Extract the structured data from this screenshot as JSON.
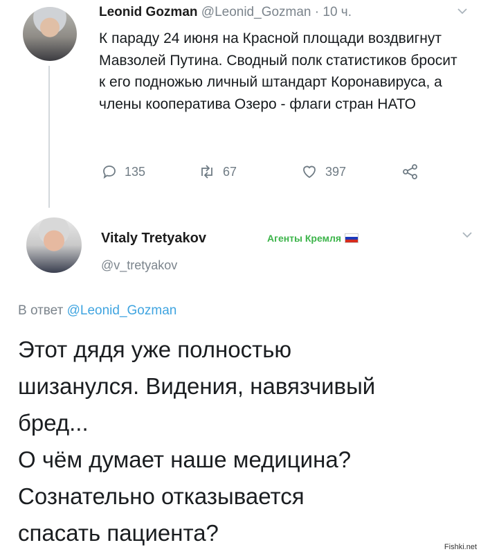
{
  "tweet1": {
    "author_name": "Leonid Gozman",
    "handle": "@Leonid_Gozman",
    "time": "· 10 ч.",
    "text": "К параду 24 июня на Красной площади воздвигнут Мавзолей Путина. Сводный полк статистиков бросит к его подножью личный штандарт Коронавируса, а члены кооператива Озеро - флаги стран НАТО",
    "replies": "135",
    "retweets": "67",
    "likes": "397"
  },
  "tweet2": {
    "author_name": "Vitaly Tretyakov",
    "badge": "Агенты Кремля",
    "handle": "@v_tretyakov",
    "reply_prefix": "В ответ",
    "reply_to": "@Leonid_Gozman",
    "lines": [
      "Этот дядя уже полностью",
      "шизанулся. Видения, навязчивый",
      "бред...",
      "О чём думает наше медицина?",
      "Сознательно отказывается",
      "спасать пациента?"
    ]
  },
  "watermark": "Fishki.net",
  "colors": {
    "link": "#3fa4e0",
    "badge": "#3cb44a",
    "muted": "#7b848c"
  }
}
